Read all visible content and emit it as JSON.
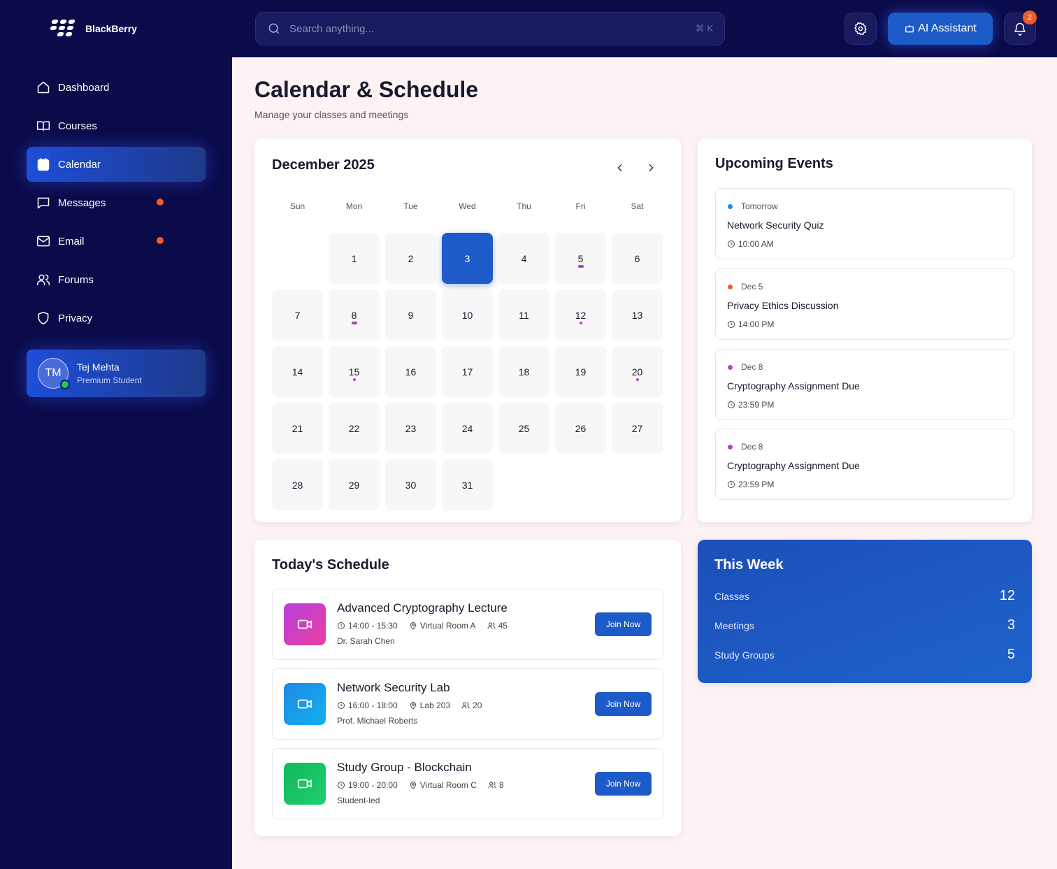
{
  "brand": {
    "name": "BlackBerry"
  },
  "sidebar": {
    "items": [
      {
        "label": "Dashboard",
        "icon": "home-icon",
        "active": false,
        "dot": false
      },
      {
        "label": "Courses",
        "icon": "book-icon",
        "active": false,
        "dot": false
      },
      {
        "label": "Calendar",
        "icon": "calendar-icon",
        "active": true,
        "dot": false
      },
      {
        "label": "Messages",
        "icon": "message-icon",
        "active": false,
        "dot": true
      },
      {
        "label": "Email",
        "icon": "mail-icon",
        "active": false,
        "dot": true
      },
      {
        "label": "Forums",
        "icon": "users-icon",
        "active": false,
        "dot": false
      },
      {
        "label": "Privacy",
        "icon": "shield-icon",
        "active": false,
        "dot": false
      }
    ],
    "user": {
      "initials": "TM",
      "name": "Tej Mehta",
      "role": "Premium Student"
    }
  },
  "topbar": {
    "search_placeholder": "Search anything...",
    "search_shortcut": "⌘ K",
    "ai_label": "AI Assistant",
    "notification_count": "2"
  },
  "page": {
    "title": "Calendar & Schedule",
    "subtitle": "Manage your classes and meetings"
  },
  "calendar": {
    "month_label": "December 2025",
    "weekdays": [
      "Sun",
      "Mon",
      "Tue",
      "Wed",
      "Thu",
      "Fri",
      "Sat"
    ],
    "first_weekday_index": 1,
    "days_in_month": 31,
    "today": 3,
    "event_days": [
      5,
      8,
      12,
      15,
      20
    ]
  },
  "upcoming": {
    "title": "Upcoming Events",
    "events": [
      {
        "date": "Tomorrow",
        "title": "Network Security Quiz",
        "time": "10:00 AM",
        "color": "#1e88e5"
      },
      {
        "date": "Dec 5",
        "title": "Privacy Ethics Discussion",
        "time": "14:00 PM",
        "color": "#f05a28"
      },
      {
        "date": "Dec 8",
        "title": "Cryptography Assignment Due",
        "time": "23:59 PM",
        "color": "#c13fcf"
      },
      {
        "date": "Dec 8",
        "title": "Cryptography Assignment Due",
        "time": "23:59 PM",
        "color": "#c13fcf"
      }
    ]
  },
  "schedule": {
    "title": "Today's Schedule",
    "items": [
      {
        "title": "Advanced Cryptography Lecture",
        "time": "14:00 - 15:30",
        "location": "Virtual Room A",
        "attendees": "45",
        "person": "Dr. Sarah Chen",
        "button": "Join Now",
        "color_from": "#b93fe0",
        "color_to": "#e83f9e"
      },
      {
        "title": "Network Security Lab",
        "time": "16:00 - 18:00",
        "location": "Lab 203",
        "attendees": "20",
        "person": "Prof. Michael Roberts",
        "button": "Join Now",
        "color_from": "#1e88e5",
        "color_to": "#12b0ef"
      },
      {
        "title": "Study Group - Blockchain",
        "time": "19:00 - 20:00",
        "location": "Virtual Room C",
        "attendees": "8",
        "person": "Student-led",
        "button": "Join Now",
        "color_from": "#12b85a",
        "color_to": "#1ed070"
      }
    ]
  },
  "week": {
    "title": "This Week",
    "stats": [
      {
        "label": "Classes",
        "value": "12"
      },
      {
        "label": "Meetings",
        "value": "3"
      },
      {
        "label": "Study Groups",
        "value": "5"
      }
    ]
  }
}
